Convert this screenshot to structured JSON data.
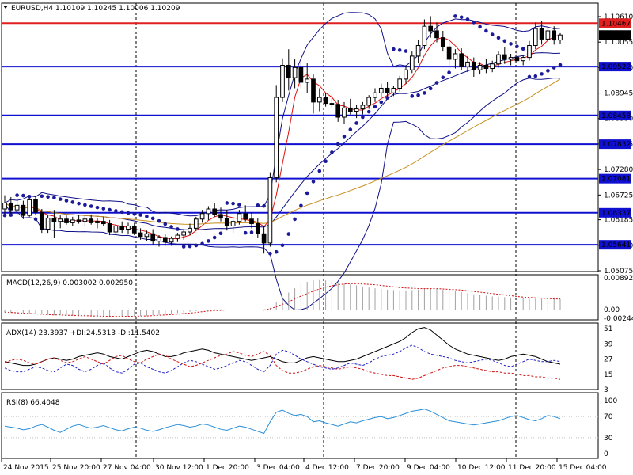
{
  "symbol_header": "EURUSD,H4  1.10109 1.10245 1.10006 1.10209",
  "chart_data": {
    "type": "candlestick",
    "symbol": "EURUSD",
    "timeframe": "H4",
    "ohlc_header": {
      "open": 1.10109,
      "high": 1.10245,
      "low": 1.10006,
      "close": 1.10209
    },
    "current_price": "1.10209",
    "price_ylim": [
      1.05075,
      1.1061
    ],
    "price_ticks": [
      "1.10610",
      "1.10055",
      "1.09500",
      "1.08945",
      "1.08390",
      "1.07835",
      "1.07280",
      "1.06725",
      "1.06185",
      "1.05630",
      "1.05075"
    ],
    "x_labels": [
      "24 Nov 2015",
      "25 Nov 20:00",
      "27 Nov 04:00",
      "30 Nov 12:00",
      "1 Dec 20:00",
      "3 Dec 04:00",
      "4 Dec 12:00",
      "7 Dec 20:00",
      "9 Dec 04:00",
      "10 Dec 12:00",
      "11 Dec 20:00",
      "15 Dec 04:00"
    ],
    "horizontal_levels": [
      {
        "price": 1.10467,
        "label": "1.10467",
        "color": "#e02020"
      },
      {
        "price": 1.09522,
        "label": "1.09522",
        "color": "#1010d0"
      },
      {
        "price": 1.08458,
        "label": "1.08458",
        "color": "#1010d0"
      },
      {
        "price": 1.07832,
        "label": "1.07832",
        "color": "#1010d0"
      },
      {
        "price": 1.07081,
        "label": "1.07081",
        "color": "#1010d0"
      },
      {
        "price": 1.06337,
        "label": "1.06337",
        "color": "#1010d0"
      },
      {
        "price": 1.05641,
        "label": "1.05641",
        "color": "#1010d0"
      }
    ],
    "candles": [
      [
        1.0642,
        1.0672,
        1.0628,
        1.0655
      ],
      [
        1.0655,
        1.0668,
        1.063,
        1.064
      ],
      [
        1.064,
        1.0663,
        1.0628,
        1.065
      ],
      [
        1.065,
        1.066,
        1.062,
        1.0628
      ],
      [
        1.0628,
        1.0668,
        1.0625,
        1.0662
      ],
      [
        1.0662,
        1.067,
        1.0628,
        1.0635
      ],
      [
        1.0635,
        1.0642,
        1.059,
        1.0598
      ],
      [
        1.0598,
        1.0628,
        1.059,
        1.0622
      ],
      [
        1.0622,
        1.064,
        1.058,
        1.0615
      ],
      [
        1.0615,
        1.0628,
        1.06,
        1.062
      ],
      [
        1.062,
        1.0628,
        1.0608,
        1.0612
      ],
      [
        1.0612,
        1.0625,
        1.0605,
        1.0618
      ],
      [
        1.0618,
        1.063,
        1.061,
        1.0615
      ],
      [
        1.0615,
        1.0628,
        1.0605,
        1.062
      ],
      [
        1.062,
        1.063,
        1.0608,
        1.0612
      ],
      [
        1.0612,
        1.0622,
        1.06,
        1.0615
      ],
      [
        1.0615,
        1.0625,
        1.0605,
        1.061
      ],
      [
        1.061,
        1.0618,
        1.0585,
        1.0592
      ],
      [
        1.0592,
        1.061,
        1.0588,
        1.0605
      ],
      [
        1.0605,
        1.0615,
        1.059,
        1.0598
      ],
      [
        1.0598,
        1.0612,
        1.0588,
        1.0605
      ],
      [
        1.0605,
        1.0612,
        1.0585,
        1.059
      ],
      [
        1.059,
        1.06,
        1.0575,
        1.0582
      ],
      [
        1.0582,
        1.0595,
        1.0572,
        1.0588
      ],
      [
        1.0588,
        1.0598,
        1.0565,
        1.0572
      ],
      [
        1.0572,
        1.0585,
        1.056,
        1.058
      ],
      [
        1.058,
        1.0588,
        1.0562,
        1.057
      ],
      [
        1.057,
        1.0582,
        1.0562,
        1.0578
      ],
      [
        1.0578,
        1.059,
        1.057,
        1.0585
      ],
      [
        1.0585,
        1.0598,
        1.0575,
        1.0592
      ],
      [
        1.0592,
        1.061,
        1.0585,
        1.06
      ],
      [
        1.06,
        1.0625,
        1.0595,
        1.062
      ],
      [
        1.062,
        1.064,
        1.0612,
        1.0632
      ],
      [
        1.0632,
        1.0648,
        1.0618,
        1.0642
      ],
      [
        1.0642,
        1.0655,
        1.0625,
        1.063
      ],
      [
        1.063,
        1.0645,
        1.0615,
        1.0622
      ],
      [
        1.0622,
        1.064,
        1.0595,
        1.0605
      ],
      [
        1.0605,
        1.0625,
        1.059,
        1.0615
      ],
      [
        1.0615,
        1.064,
        1.0608,
        1.0632
      ],
      [
        1.0632,
        1.065,
        1.0615,
        1.062
      ],
      [
        1.062,
        1.0635,
        1.06,
        1.061
      ],
      [
        1.061,
        1.0622,
        1.058,
        1.0588
      ],
      [
        1.0588,
        1.0605,
        1.0545,
        1.0568
      ],
      [
        1.0568,
        1.0722,
        1.056,
        1.071
      ],
      [
        1.071,
        1.0912,
        1.07,
        1.0885
      ],
      [
        1.0885,
        1.097,
        1.0875,
        1.0955
      ],
      [
        1.0955,
        1.099,
        1.09,
        1.0928
      ],
      [
        1.0928,
        1.0968,
        1.0905,
        1.095
      ],
      [
        1.095,
        1.0962,
        1.0905,
        1.0918
      ],
      [
        1.0918,
        1.096,
        1.0895,
        1.0925
      ],
      [
        1.0925,
        1.0935,
        1.085,
        1.0875
      ],
      [
        1.0875,
        1.0905,
        1.0855,
        1.0885
      ],
      [
        1.0885,
        1.0895,
        1.0865,
        1.0872
      ],
      [
        1.0872,
        1.089,
        1.0862,
        1.087
      ],
      [
        1.087,
        1.088,
        1.0832,
        1.0842
      ],
      [
        1.0842,
        1.0875,
        1.0828,
        1.0862
      ],
      [
        1.0862,
        1.0882,
        1.0848,
        1.0855
      ],
      [
        1.0855,
        1.0868,
        1.084,
        1.086
      ],
      [
        1.086,
        1.0875,
        1.0848,
        1.0868
      ],
      [
        1.0868,
        1.089,
        1.086,
        1.0885
      ],
      [
        1.0885,
        1.0905,
        1.0875,
        1.0895
      ],
      [
        1.0895,
        1.0915,
        1.0885,
        1.0905
      ],
      [
        1.0905,
        1.0918,
        1.0885,
        1.0895
      ],
      [
        1.0895,
        1.091,
        1.0888,
        1.0905
      ],
      [
        1.0905,
        1.0932,
        1.0898,
        1.0925
      ],
      [
        1.0925,
        1.0955,
        1.0915,
        1.0945
      ],
      [
        1.0945,
        1.0985,
        1.0938,
        1.0975
      ],
      [
        1.0975,
        1.101,
        1.096,
        1.0998
      ],
      [
        1.0998,
        1.1055,
        1.099,
        1.104
      ],
      [
        1.104,
        1.1062,
        1.1015,
        1.103
      ],
      [
        1.103,
        1.1048,
        1.1005,
        1.1015
      ],
      [
        1.1015,
        1.103,
        1.0985,
        1.0995
      ],
      [
        1.0995,
        1.1005,
        1.0955,
        1.0968
      ],
      [
        1.0968,
        1.099,
        1.0948,
        1.098
      ],
      [
        1.098,
        1.0992,
        1.0945,
        1.0952
      ],
      [
        1.0952,
        1.0975,
        1.094,
        1.0962
      ],
      [
        1.0962,
        1.0972,
        1.093,
        1.0945
      ],
      [
        1.0945,
        1.0962,
        1.0935,
        1.0955
      ],
      [
        1.0955,
        1.0968,
        1.0938,
        1.0948
      ],
      [
        1.0948,
        1.0965,
        1.094,
        1.0958
      ],
      [
        1.0958,
        1.0985,
        1.095,
        1.0978
      ],
      [
        1.0978,
        1.0995,
        1.0958,
        1.0968
      ],
      [
        1.0968,
        1.098,
        1.0955,
        1.0972
      ],
      [
        1.0972,
        1.099,
        1.096,
        1.0965
      ],
      [
        1.0965,
        1.0978,
        1.0955,
        1.0972
      ],
      [
        1.0972,
        1.1008,
        1.0965,
        1.0998
      ],
      [
        1.0998,
        1.1048,
        1.099,
        1.1035
      ],
      [
        1.1035,
        1.1052,
        1.1,
        1.1012
      ],
      [
        1.1012,
        1.1038,
        1.1005,
        1.103
      ],
      [
        1.103,
        1.104,
        1.1,
        1.101
      ],
      [
        1.101,
        1.1025,
        1.1001,
        1.1021
      ]
    ],
    "indicators_on_price": [
      "Bollinger Bands",
      "Parabolic SAR",
      "Moving Average (fast)",
      "Moving Average (slow)"
    ],
    "macd": {
      "label": "MACD(12,26,9) 0.003002 0.002950",
      "ticks": [
        "0.008922",
        "0.00",
        "-0.002443"
      ],
      "ylim": [
        -0.002443,
        0.008922
      ],
      "histogram": [
        -0.0008,
        -0.0009,
        -0.001,
        -0.0011,
        -0.0012,
        -0.0013,
        -0.0014,
        -0.0015,
        -0.0016,
        -0.0016,
        -0.0017,
        -0.0017,
        -0.0018,
        -0.0018,
        -0.0019,
        -0.0019,
        -0.002,
        -0.002,
        -0.002,
        -0.002,
        -0.0019,
        -0.0019,
        -0.0018,
        -0.0017,
        -0.0016,
        -0.0015,
        -0.0014,
        -0.0012,
        -0.001,
        -0.0008,
        -0.0006,
        -0.0004,
        -0.0002,
        0.0,
        0.0001,
        0.0001,
        0.0,
        -0.0001,
        0.0,
        0.0,
        -0.0001,
        -0.0002,
        -0.0003,
        0.0005,
        0.002,
        0.0035,
        0.0048,
        0.006,
        0.007,
        0.0078,
        0.0082,
        0.0083,
        0.0082,
        0.008,
        0.0077,
        0.0074,
        0.0071,
        0.0068,
        0.0065,
        0.0062,
        0.006,
        0.0058,
        0.0056,
        0.0055,
        0.0054,
        0.0054,
        0.0055,
        0.0056,
        0.0058,
        0.0059,
        0.0058,
        0.0056,
        0.0054,
        0.0052,
        0.0049,
        0.0046,
        0.0043,
        0.0041,
        0.0039,
        0.0037,
        0.0036,
        0.0035,
        0.0034,
        0.0033,
        0.0032,
        0.0031,
        0.0031,
        0.003,
        0.003,
        0.003,
        0.003
      ],
      "signal": [
        -0.0007,
        -0.0008,
        -0.0009,
        -0.001,
        -0.0011,
        -0.0012,
        -0.0013,
        -0.0014,
        -0.0015,
        -0.0015,
        -0.0016,
        -0.0016,
        -0.0017,
        -0.0017,
        -0.0018,
        -0.0018,
        -0.0019,
        -0.0019,
        -0.0019,
        -0.0019,
        -0.0019,
        -0.0019,
        -0.0018,
        -0.0018,
        -0.0017,
        -0.0016,
        -0.0015,
        -0.0014,
        -0.0013,
        -0.0011,
        -0.001,
        -0.0008,
        -0.0006,
        -0.0004,
        -0.0003,
        -0.0002,
        -0.0001,
        -0.0001,
        -0.0001,
        -0.0001,
        -0.0001,
        -0.0001,
        -0.0001,
        0.0002,
        0.0008,
        0.0015,
        0.0022,
        0.003,
        0.0038,
        0.0045,
        0.0052,
        0.0058,
        0.0063,
        0.0067,
        0.007,
        0.0072,
        0.0073,
        0.0073,
        0.0072,
        0.0071,
        0.007,
        0.0068,
        0.0066,
        0.0064,
        0.0062,
        0.0061,
        0.006,
        0.0059,
        0.0059,
        0.0059,
        0.0059,
        0.0058,
        0.0057,
        0.0056,
        0.0055,
        0.0053,
        0.0051,
        0.0049,
        0.0047,
        0.0045,
        0.0043,
        0.0041,
        0.0039,
        0.0037,
        0.0035,
        0.0034,
        0.0033,
        0.0032,
        0.0031,
        0.003,
        0.003
      ]
    },
    "adx": {
      "label": "ADX(14) 23.3937 +DI:24.5313 -DI:11.5402",
      "ticks": [
        "51",
        "39",
        "27",
        "15",
        "3"
      ],
      "ylim": [
        3,
        53
      ],
      "adx": [
        25,
        24,
        23,
        22,
        22,
        23,
        25,
        27,
        28,
        27,
        26,
        27,
        29,
        30,
        31,
        32,
        31,
        29,
        28,
        27,
        29,
        31,
        33,
        34,
        33,
        31,
        29,
        29,
        30,
        32,
        33,
        34,
        35,
        34,
        32,
        31,
        30,
        29,
        28,
        27,
        26,
        27,
        28,
        29,
        27,
        25,
        24,
        24,
        26,
        28,
        29,
        28,
        27,
        26,
        25,
        25,
        26,
        27,
        29,
        31,
        33,
        35,
        37,
        39,
        41,
        44,
        48,
        51,
        52,
        50,
        46,
        42,
        38,
        35,
        33,
        31,
        30,
        29,
        28,
        27,
        26,
        27,
        29,
        30,
        31,
        30,
        29,
        27,
        25,
        24,
        23
      ],
      "plus_di": [
        20,
        18,
        17,
        17,
        19,
        21,
        20,
        18,
        17,
        20,
        23,
        22,
        19,
        17,
        19,
        22,
        24,
        20,
        17,
        16,
        19,
        23,
        24,
        21,
        19,
        17,
        16,
        18,
        21,
        24,
        26,
        25,
        23,
        21,
        19,
        20,
        22,
        24,
        26,
        25,
        22,
        19,
        17,
        22,
        31,
        34,
        33,
        30,
        27,
        25,
        23,
        21,
        20,
        19,
        20,
        22,
        24,
        23,
        22,
        24,
        27,
        29,
        30,
        31,
        33,
        36,
        38,
        36,
        33,
        31,
        30,
        29,
        28,
        26,
        25,
        24,
        25,
        26,
        27,
        26,
        24,
        22,
        21,
        23,
        25,
        27,
        26,
        25,
        25,
        26,
        25
      ],
      "minus_di": [
        24,
        26,
        27,
        26,
        24,
        23,
        25,
        27,
        28,
        26,
        24,
        25,
        27,
        29,
        27,
        25,
        23,
        26,
        29,
        30,
        27,
        25,
        24,
        27,
        29,
        31,
        30,
        27,
        25,
        23,
        21,
        22,
        24,
        26,
        28,
        30,
        31,
        33,
        32,
        30,
        29,
        31,
        33,
        30,
        22,
        18,
        16,
        16,
        17,
        19,
        21,
        22,
        21,
        20,
        19,
        20,
        21,
        20,
        19,
        17,
        16,
        15,
        14,
        14,
        13,
        12,
        11,
        12,
        14,
        16,
        18,
        20,
        21,
        22,
        22,
        21,
        20,
        19,
        18,
        17,
        17,
        16,
        16,
        15,
        14,
        14,
        13,
        13,
        12,
        12,
        11
      ]
    },
    "rsi": {
      "label": "RSI(8) 66.4048",
      "ticks": [
        "100",
        "70",
        "30",
        "0"
      ],
      "ylim": [
        0,
        100
      ],
      "values": [
        52,
        50,
        48,
        45,
        47,
        52,
        55,
        50,
        44,
        40,
        46,
        52,
        55,
        51,
        48,
        50,
        53,
        49,
        45,
        43,
        47,
        50,
        48,
        44,
        42,
        45,
        49,
        52,
        55,
        53,
        50,
        52,
        56,
        54,
        50,
        46,
        44,
        48,
        52,
        50,
        46,
        42,
        38,
        60,
        78,
        82,
        76,
        72,
        74,
        70,
        60,
        62,
        58,
        55,
        52,
        56,
        60,
        58,
        62,
        65,
        68,
        70,
        66,
        68,
        72,
        76,
        80,
        82,
        84,
        80,
        74,
        68,
        62,
        60,
        58,
        56,
        54,
        56,
        58,
        60,
        62,
        66,
        70,
        72,
        68,
        64,
        62,
        66,
        72,
        70,
        66
      ]
    }
  }
}
